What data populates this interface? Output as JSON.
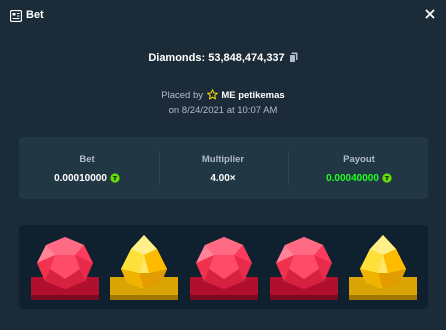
{
  "header": {
    "title": "Bet",
    "app_icon": "bet-slip-icon",
    "close_icon": "close-icon"
  },
  "diamonds": {
    "label": "Diamonds: 53,848,474,337",
    "copy_icon": "copy-icon"
  },
  "placed": {
    "prefix": "Placed by",
    "user": "ME petikemas",
    "date": "on 8/24/2021 at 10:07 AM",
    "badge_icon": "star-icon"
  },
  "stats": {
    "bet": {
      "label": "Bet",
      "value": "0.00010000",
      "currency_icon": "coin-icon"
    },
    "multiplier": {
      "label": "Multiplier",
      "value": "4.00×"
    },
    "payout": {
      "label": "Payout",
      "value": "0.00040000",
      "currency_icon": "coin-icon"
    }
  },
  "gems": [
    {
      "type": "ruby",
      "color": "#ff3b5c"
    },
    {
      "type": "topaz",
      "color": "#ffc800"
    },
    {
      "type": "ruby",
      "color": "#ff3b5c"
    },
    {
      "type": "ruby",
      "color": "#ff3b5c"
    },
    {
      "type": "topaz",
      "color": "#ffc800"
    }
  ],
  "colors": {
    "background": "#1b2c38",
    "panel": "#213743",
    "board": "#0f212e",
    "payout": "#1fff20"
  }
}
